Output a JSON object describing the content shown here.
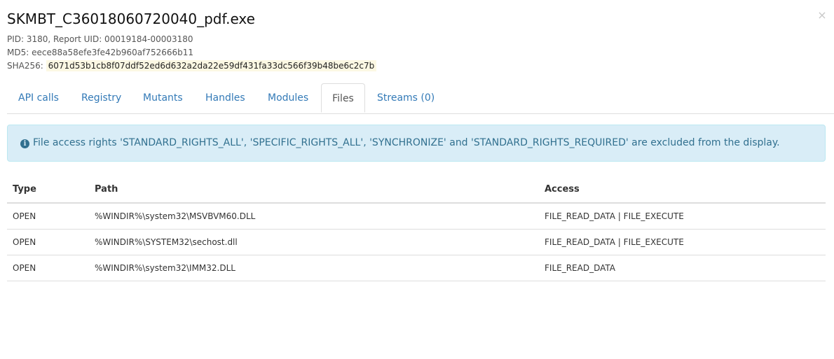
{
  "header": {
    "title": "SKMBT_C36018060720040_pdf.exe",
    "close_label": "×",
    "pid_line": "PID: 3180, Report UID: 00019184-00003180",
    "md5_line": "MD5: eece88a58efe3fe42b960af752666b11",
    "sha256_label": "SHA256:",
    "sha256_value": "6071d53b1cb8f07ddf52ed6d632a2da22e59df431fa33dc566f39b48be6c2c7b"
  },
  "tabs": [
    {
      "label": "API calls",
      "active": false
    },
    {
      "label": "Registry",
      "active": false
    },
    {
      "label": "Mutants",
      "active": false
    },
    {
      "label": "Handles",
      "active": false
    },
    {
      "label": "Modules",
      "active": false
    },
    {
      "label": "Files",
      "active": true
    },
    {
      "label": "Streams (0)",
      "active": false
    }
  ],
  "alert": {
    "icon": "info-circle-icon",
    "text": "File access rights 'STANDARD_RIGHTS_ALL', 'SPECIFIC_RIGHTS_ALL', 'SYNCHRONIZE' and 'STANDARD_RIGHTS_REQUIRED' are excluded from the display."
  },
  "table": {
    "headers": [
      "Type",
      "Path",
      "Access"
    ],
    "rows": [
      {
        "type": "OPEN",
        "path": "%WINDIR%\\system32\\MSVBVM60.DLL",
        "access": "FILE_READ_DATA | FILE_EXECUTE"
      },
      {
        "type": "OPEN",
        "path": "%WINDIR%\\SYSTEM32\\sechost.dll",
        "access": "FILE_READ_DATA | FILE_EXECUTE"
      },
      {
        "type": "OPEN",
        "path": "%WINDIR%\\system32\\IMM32.DLL",
        "access": "FILE_READ_DATA"
      }
    ]
  },
  "colors": {
    "link": "#337ab7",
    "alert_bg": "#d9edf7",
    "alert_text": "#31708f",
    "highlight_bg": "#fcf8e3"
  }
}
